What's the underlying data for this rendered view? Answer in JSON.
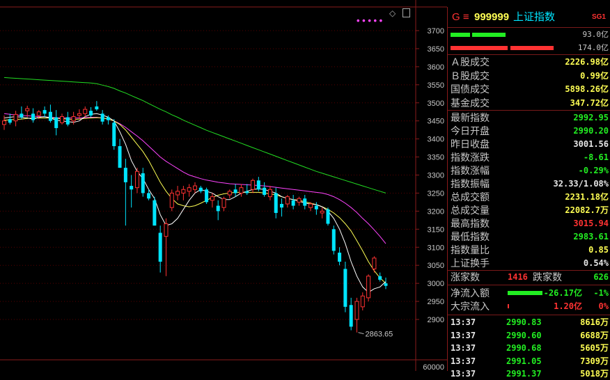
{
  "tabs": [
    "",
    "",
    "",
    ""
  ],
  "chart": {
    "price_axis_labels": [
      "3700",
      "3650",
      "3600",
      "3550",
      "3500",
      "3450",
      "3400",
      "3350",
      "3300",
      "3250",
      "3200",
      "3150",
      "3100",
      "3050",
      "3000",
      "2950",
      "2900"
    ],
    "volume_axis_label": "60000",
    "low_marker": "2863.65",
    "ma_dots": "• • • • •",
    "colors": {
      "up": "#ff3232",
      "down": "#00e5ff",
      "ma5": "#ffffff",
      "ma10": "#ffff54",
      "ma20": "#ff44ff",
      "ma60": "#22dd22",
      "grid": "#5a0000"
    }
  },
  "header": {
    "code_prefix": "G ≡",
    "code": "999999",
    "name": "上证指数",
    "badge": "SG1"
  },
  "bars": [
    {
      "label": "93.0亿",
      "color": "#22ee22"
    },
    {
      "label": "174.0亿",
      "color": "#ff3232"
    }
  ],
  "turnover": [
    {
      "label": "Ａ股成交",
      "value": "2226.98亿"
    },
    {
      "label": "Ｂ股成交",
      "value": "0.99亿"
    },
    {
      "label": "国债成交",
      "value": "5898.26亿"
    },
    {
      "label": "基金成交",
      "value": "347.72亿"
    }
  ],
  "quote": [
    {
      "label": "最新指数",
      "value": "2992.95",
      "color": "green"
    },
    {
      "label": "今日开盘",
      "value": "2990.20",
      "color": "green"
    },
    {
      "label": "昨日收盘",
      "value": "3001.56",
      "color": "white"
    },
    {
      "label": "指数涨跌",
      "value": "-8.61",
      "color": "green"
    },
    {
      "label": "指数涨幅",
      "value": "-0.29%",
      "color": "green"
    },
    {
      "label": "指数振幅",
      "value": "32.33/1.08%",
      "color": "white"
    },
    {
      "label": "总成交额",
      "value": "2231.18亿",
      "color": "yellow"
    },
    {
      "label": "总成交量",
      "value": "22082.7万",
      "color": "yellow"
    },
    {
      "label": "最高指数",
      "value": "3015.94",
      "color": "red"
    },
    {
      "label": "最低指数",
      "value": "2983.61",
      "color": "green"
    },
    {
      "label": "指数量比",
      "value": "0.85",
      "color": "yellow"
    },
    {
      "label": "上证换手",
      "value": "0.54%",
      "color": "white"
    }
  ],
  "breadth": {
    "up_label": "涨家数",
    "up_value": "1416",
    "down_label": "跌家数",
    "down_value": "626"
  },
  "flows": [
    {
      "label": "净流入额",
      "value": "-26.17亿",
      "pct": "-1%",
      "color": "green",
      "bar_color": "#22ee22",
      "bar_frac": 0.8
    },
    {
      "label": "大宗流入",
      "value": "1.20亿",
      "pct": "0%",
      "color": "red",
      "bar_color": "#ff3232",
      "bar_frac": 0.03
    }
  ],
  "ticks": [
    {
      "time": "13:37",
      "price": "2990.83",
      "vol": "8616万"
    },
    {
      "time": "13:37",
      "price": "2990.60",
      "vol": "6688万"
    },
    {
      "time": "13:37",
      "price": "2990.68",
      "vol": "5605万"
    },
    {
      "time": "13:37",
      "price": "2991.05",
      "vol": "7309万"
    },
    {
      "time": "13:37",
      "price": "2991.37",
      "vol": "5018万"
    }
  ],
  "chart_data": {
    "type": "candlestick",
    "ylim": [
      2850,
      3720
    ],
    "candles": [
      [
        3440,
        3465,
        3425,
        3450
      ],
      [
        3455,
        3470,
        3440,
        3445
      ],
      [
        3450,
        3478,
        3435,
        3468
      ],
      [
        3470,
        3490,
        3455,
        3460
      ],
      [
        3478,
        3492,
        3460,
        3484
      ],
      [
        3470,
        3485,
        3445,
        3452
      ],
      [
        3465,
        3480,
        3455,
        3475
      ],
      [
        3480,
        3490,
        3460,
        3470
      ],
      [
        3475,
        3495,
        3445,
        3450
      ],
      [
        3460,
        3480,
        3410,
        3430
      ],
      [
        3445,
        3470,
        3440,
        3462
      ],
      [
        3460,
        3475,
        3435,
        3440
      ],
      [
        3450,
        3475,
        3440,
        3462
      ],
      [
        3465,
        3482,
        3455,
        3470
      ],
      [
        3470,
        3490,
        3460,
        3482
      ],
      [
        3478,
        3488,
        3460,
        3465
      ],
      [
        3490,
        3505,
        3478,
        3482
      ],
      [
        3470,
        3480,
        3440,
        3448
      ],
      [
        3460,
        3465,
        3440,
        3452
      ],
      [
        3445,
        3455,
        3370,
        3380
      ],
      [
        3380,
        3400,
        3320,
        3320
      ],
      [
        3320,
        3345,
        3160,
        3280
      ],
      [
        3270,
        3300,
        3210,
        3260
      ],
      [
        3265,
        3320,
        3250,
        3310
      ],
      [
        3305,
        3320,
        3240,
        3250
      ],
      [
        3250,
        3260,
        3230,
        3235
      ],
      [
        3230,
        3240,
        3160,
        3160
      ],
      [
        3140,
        3160,
        3030,
        3060
      ],
      [
        3130,
        3180,
        3020,
        3165
      ],
      [
        3210,
        3260,
        3200,
        3250
      ],
      [
        3245,
        3270,
        3230,
        3255
      ],
      [
        3250,
        3270,
        3230,
        3260
      ],
      [
        3255,
        3275,
        3240,
        3265
      ],
      [
        3260,
        3280,
        3250,
        3270
      ],
      [
        3265,
        3270,
        3250,
        3255
      ],
      [
        3260,
        3265,
        3220,
        3225
      ],
      [
        3230,
        3250,
        3210,
        3240
      ],
      [
        3215,
        3230,
        3175,
        3200
      ],
      [
        3210,
        3240,
        3200,
        3235
      ],
      [
        3245,
        3260,
        3235,
        3255
      ],
      [
        3260,
        3275,
        3240,
        3250
      ],
      [
        3250,
        3275,
        3240,
        3265
      ],
      [
        3255,
        3275,
        3245,
        3250
      ],
      [
        3260,
        3290,
        3250,
        3285
      ],
      [
        3285,
        3295,
        3255,
        3260
      ],
      [
        3265,
        3280,
        3240,
        3245
      ],
      [
        3240,
        3270,
        3230,
        3260
      ],
      [
        3250,
        3265,
        3180,
        3195
      ],
      [
        3220,
        3235,
        3185,
        3210
      ],
      [
        3220,
        3245,
        3210,
        3240
      ],
      [
        3230,
        3245,
        3205,
        3215
      ],
      [
        3225,
        3240,
        3215,
        3235
      ],
      [
        3235,
        3245,
        3205,
        3215
      ],
      [
        3210,
        3225,
        3200,
        3220
      ],
      [
        3215,
        3225,
        3190,
        3205
      ],
      [
        3195,
        3210,
        3180,
        3200
      ],
      [
        3205,
        3210,
        3160,
        3165
      ],
      [
        3150,
        3160,
        3080,
        3090
      ],
      [
        3085,
        3100,
        3050,
        3060
      ],
      [
        3040,
        3060,
        2920,
        2935
      ],
      [
        2940,
        2960,
        2870,
        2880
      ],
      [
        2900,
        2960,
        2864,
        2950
      ],
      [
        2935,
        2975,
        2925,
        2965
      ],
      [
        2960,
        3025,
        2950,
        3020
      ],
      [
        3040,
        3075,
        3030,
        3070
      ],
      [
        3020,
        3030,
        3005,
        3010
      ],
      [
        3000,
        3016,
        2984,
        2993
      ]
    ],
    "ma5": [
      3458,
      3460,
      3462,
      3460,
      3458,
      3455,
      3460,
      3462,
      3458,
      3452,
      3450,
      3448,
      3446,
      3450,
      3462,
      3468,
      3470,
      3466,
      3460,
      3450,
      3420,
      3385,
      3340,
      3310,
      3290,
      3260,
      3235,
      3190,
      3160,
      3165,
      3180,
      3205,
      3230,
      3250,
      3260,
      3255,
      3250,
      3240,
      3232,
      3232,
      3240,
      3250,
      3255,
      3260,
      3262,
      3260,
      3255,
      3250,
      3240,
      3235,
      3232,
      3228,
      3222,
      3220,
      3218,
      3212,
      3200,
      3180,
      3150,
      3110,
      3060,
      3020,
      2990,
      2975,
      2985,
      2990,
      3005
    ],
    "ma10": [
      3452,
      3453,
      3454,
      3455,
      3457,
      3458,
      3458,
      3458,
      3458,
      3457,
      3456,
      3455,
      3454,
      3455,
      3457,
      3458,
      3459,
      3458,
      3455,
      3450,
      3440,
      3425,
      3405,
      3385,
      3365,
      3340,
      3310,
      3280,
      3255,
      3235,
      3220,
      3215,
      3212,
      3215,
      3222,
      3230,
      3238,
      3244,
      3248,
      3250,
      3252,
      3252,
      3252,
      3252,
      3252,
      3250,
      3248,
      3245,
      3240,
      3235,
      3232,
      3230,
      3226,
      3222,
      3218,
      3212,
      3205,
      3195,
      3182,
      3165,
      3145,
      3118,
      3090,
      3060,
      3035,
      3015,
      3000
    ],
    "ma20": [
      3470,
      3468,
      3466,
      3465,
      3464,
      3463,
      3462,
      3461,
      3460,
      3459,
      3458,
      3458,
      3458,
      3458,
      3459,
      3460,
      3460,
      3458,
      3455,
      3450,
      3442,
      3432,
      3420,
      3408,
      3395,
      3380,
      3365,
      3350,
      3338,
      3328,
      3318,
      3308,
      3300,
      3295,
      3290,
      3286,
      3283,
      3280,
      3278,
      3276,
      3275,
      3274,
      3273,
      3272,
      3271,
      3270,
      3268,
      3266,
      3264,
      3262,
      3260,
      3258,
      3256,
      3254,
      3252,
      3250,
      3246,
      3240,
      3232,
      3222,
      3210,
      3196,
      3180,
      3165,
      3148,
      3130,
      3110
    ],
    "ma60": [
      3570,
      3569,
      3568,
      3567,
      3566,
      3565,
      3564,
      3563,
      3562,
      3561,
      3560,
      3559,
      3558,
      3557,
      3556,
      3555,
      3553,
      3549,
      3545,
      3540,
      3533,
      3527,
      3520,
      3513,
      3506,
      3498,
      3490,
      3482,
      3475,
      3467,
      3460,
      3452,
      3445,
      3438,
      3431,
      3424,
      3418,
      3412,
      3406,
      3400,
      3394,
      3388,
      3382,
      3376,
      3370,
      3364,
      3358,
      3352,
      3346,
      3340,
      3334,
      3328,
      3322,
      3316,
      3310,
      3305,
      3300,
      3295,
      3290,
      3285,
      3280,
      3275,
      3270,
      3265,
      3260,
      3255,
      3250
    ]
  }
}
